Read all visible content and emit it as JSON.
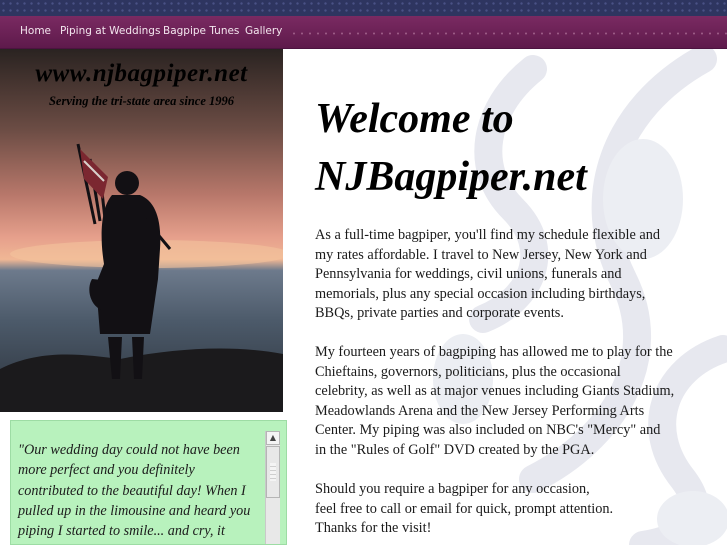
{
  "nav": {
    "items": [
      "Home",
      "Piping at Weddings",
      "Bagpipe Tunes",
      "Gallery"
    ]
  },
  "hero": {
    "url": "www.njbagpiper.net",
    "tagline": "Serving the tri-state area since 1996"
  },
  "main": {
    "heading_lines": [
      "Welcome to",
      "NJBagpiper.net"
    ],
    "paragraph1_lines": [
      "As a full-time bagpiper, you'll find my schedule flexible and",
      "my rates affordable. I travel to New Jersey, New York and",
      "Pennsylvania for weddings, civil unions, funerals and",
      "memorials, plus any special occasion including birthdays,",
      "BBQs, private parties and corporate events."
    ],
    "paragraph2_lines": [
      "My fourteen years of bagpiping has allowed me to play for the",
      "Chieftains, governors, politicians, plus the occasional",
      "celebrity, as well as at major venues including Giants Stadium,",
      "Meadowlands Arena and the New Jersey Performing Arts",
      "Center.  My piping was also included on NBC's \"Mercy\" and",
      "in the \"Rules of Golf\" DVD created by the PGA."
    ],
    "paragraph3_lines": [
      "Should you require a bagpiper for any occasion,",
      "feel free to call or email for quick, prompt attention.",
      "Thanks for the visit!"
    ]
  },
  "testimonial": {
    "lines": [
      "\"Our wedding day could not have been",
      "more perfect and you definitely",
      "contributed to the beautiful day! When I",
      "pulled up in the limousine and heard you",
      "piping I started to smile... and cry, it"
    ]
  },
  "icons": {
    "scroll_up": "scroll-up-arrow-icon"
  },
  "colors": {
    "navbar": "#6b2157",
    "top_strip": "#2e3560",
    "testimonial_bg": "#b8f2bd",
    "swirl": "#e7e8ef"
  }
}
